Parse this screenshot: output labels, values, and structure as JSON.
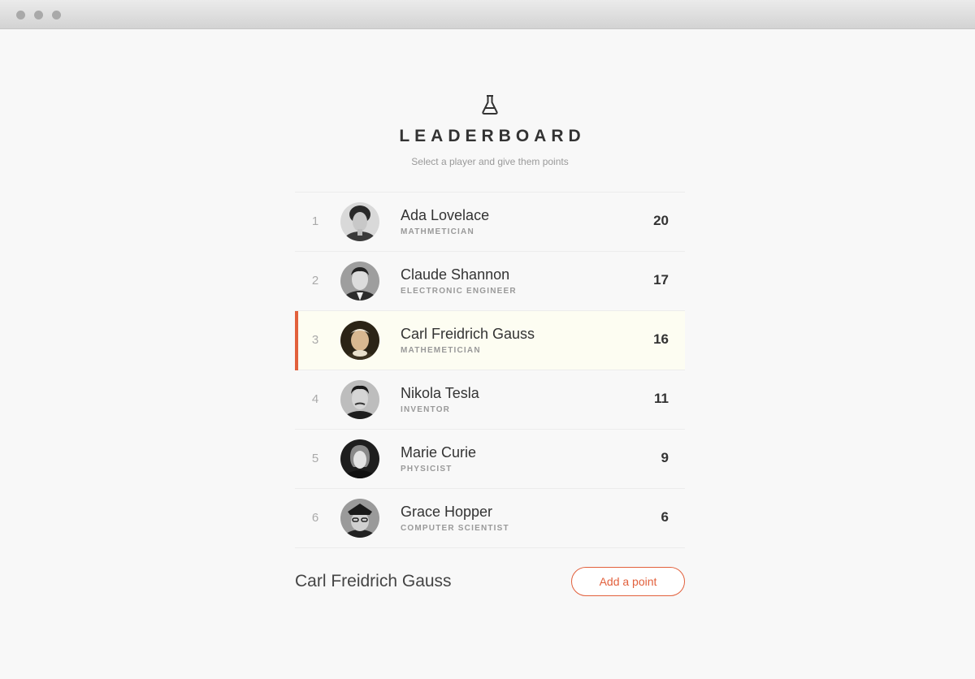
{
  "header": {
    "icon": "flask-icon",
    "title": "LEADERBOARD",
    "subtitle": "Select a player and give them points"
  },
  "players": [
    {
      "rank": "1",
      "name": "Ada Lovelace",
      "role": "MATHMETICIAN",
      "score": "20",
      "selected": false
    },
    {
      "rank": "2",
      "name": "Claude Shannon",
      "role": "ELECTRONIC ENGINEER",
      "score": "17",
      "selected": false
    },
    {
      "rank": "3",
      "name": "Carl Freidrich Gauss",
      "role": "MATHEMETICIAN",
      "score": "16",
      "selected": true
    },
    {
      "rank": "4",
      "name": "Nikola Tesla",
      "role": "INVENTOR",
      "score": "11",
      "selected": false
    },
    {
      "rank": "5",
      "name": "Marie Curie",
      "role": "PHYSICIST",
      "score": "9",
      "selected": false
    },
    {
      "rank": "6",
      "name": "Grace Hopper",
      "role": "COMPUTER SCIENTIST",
      "score": "6",
      "selected": false
    }
  ],
  "footer": {
    "selected_name": "Carl Freidrich Gauss",
    "add_label": "Add a point"
  },
  "colors": {
    "accent": "#e2603c",
    "selected_bg": "#fdfdf2"
  }
}
